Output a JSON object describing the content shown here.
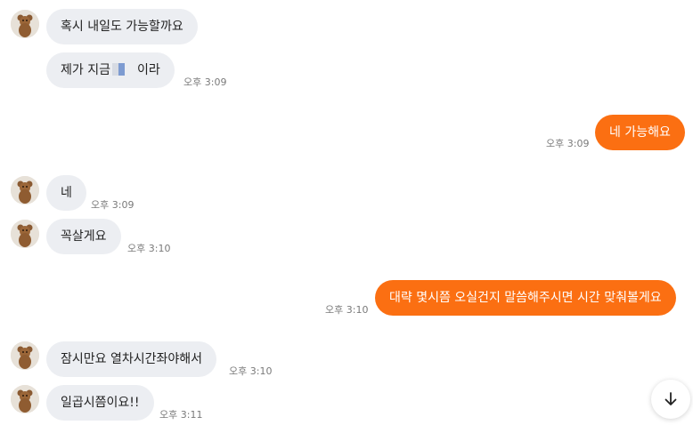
{
  "messages": [
    {
      "text": "혹시 내일도 가능할까요"
    },
    {
      "text_before": "제가 지금",
      "text_after": "이라",
      "time": "오후 3:09"
    },
    {
      "text": "네 가능해요",
      "time": "오후 3:09"
    },
    {
      "text": "네",
      "time": "오후 3:09"
    },
    {
      "text": "꼭살게요",
      "time": "오후 3:10"
    },
    {
      "text": "대략 몇시쯤 오실건지 말씀해주시면 시간 맞춰볼게요",
      "time": "오후 3:10"
    },
    {
      "text": "잠시만요 열차시간좌야해서",
      "time": "오후 3:10"
    },
    {
      "text": "일곱시쯤이요!!",
      "time": "오후 3:11"
    }
  ],
  "icons": {
    "avatar": "teddy-bear-avatar",
    "scroll_down": "arrow-down-icon"
  },
  "colors": {
    "outgoing_bubble": "#fb6f12",
    "incoming_bubble": "#eceef2",
    "timestamp": "#7a7a7a"
  }
}
